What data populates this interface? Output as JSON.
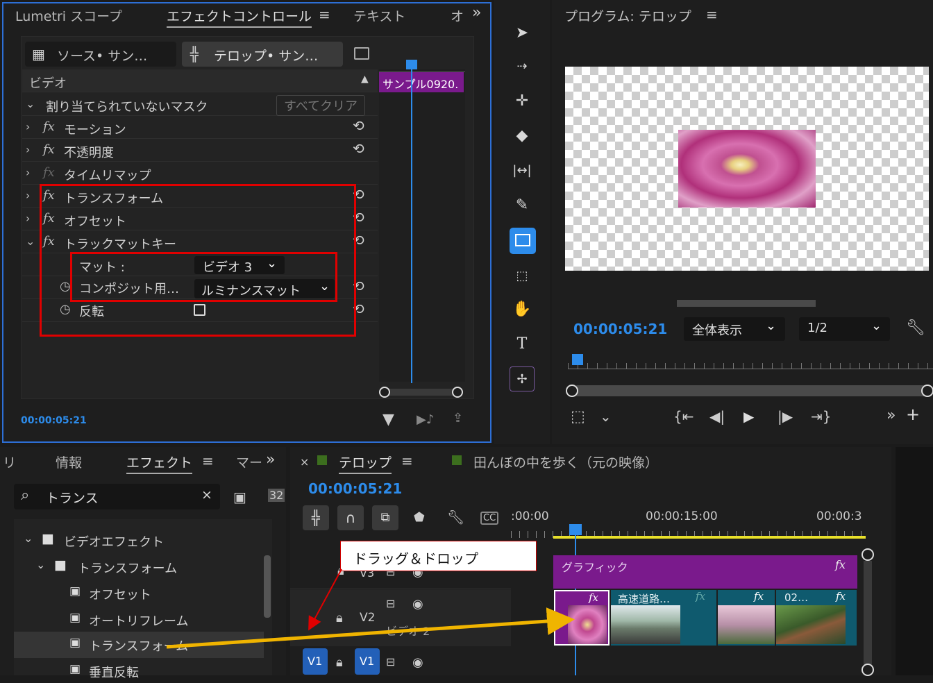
{
  "effect_panel": {
    "tabs": [
      "Lumetri スコープ",
      "エフェクトコントロール",
      "テキスト",
      "オ"
    ],
    "more_tabs": "»",
    "menu_glyph": "≡",
    "source_label": "ソース• サン…",
    "sequence_label": "テロップ• サン…",
    "section_label": "ビデオ",
    "clip_label": "サンプル0920.",
    "mask_label": "割り当てられていないマスク",
    "clear_all": "すべてクリア",
    "rows": [
      {
        "label": "モーション"
      },
      {
        "label": "不透明度"
      },
      {
        "label": "タイムリマップ"
      },
      {
        "label": "トランスフォーム"
      },
      {
        "label": "オフセット"
      },
      {
        "label": "トラックマットキー"
      }
    ],
    "matte_label": "マット :",
    "matte_value": "ビデオ 3",
    "composite_label": "コンポジット用…",
    "composite_value": "ルミナンスマット",
    "invert_label": "反転",
    "timecode": "00:00:05:21"
  },
  "program_monitor": {
    "title": "プログラム: テロップ",
    "timecode": "00:00:05:21",
    "zoom": "全体表示",
    "resolution": "1/2"
  },
  "effects_panel": {
    "tabs": [
      "リ",
      "情報",
      "エフェクト",
      "マー"
    ],
    "search_value": "トランス",
    "tree": [
      {
        "label": "ビデオエフェクト"
      },
      {
        "label": "トランスフォーム"
      },
      {
        "label": "オフセット"
      },
      {
        "label": "オートリフレーム"
      },
      {
        "label": "トランスフォーム"
      },
      {
        "label": "垂直反転"
      }
    ]
  },
  "timeline": {
    "close": "×",
    "tab_active": "テロップ",
    "tab_other": "田んぼの中を歩く（元の映像）",
    "timecode": "00:00:05:21",
    "ruler_labels": [
      ":00:00",
      "00:00:15:00",
      "00:00:3"
    ],
    "graphic_clip": "グラフィック",
    "clip_highway": "高速道路…",
    "clip_02": "02…",
    "track_v3": "V3",
    "track_v2": "V2",
    "track_v1": "V1",
    "track_name_v2": "ビデオ 2",
    "source_v1": "V1",
    "fx_badge": "fx"
  },
  "annotation": {
    "callout": "ドラッグ＆ドロップ"
  },
  "colors": {
    "accent_blue": "#2d8ceb",
    "clip_purple": "#7a1a8c",
    "clip_teal": "#0f5a6e",
    "highlight_red": "#e00000",
    "arrow_yellow": "#f0b400"
  }
}
